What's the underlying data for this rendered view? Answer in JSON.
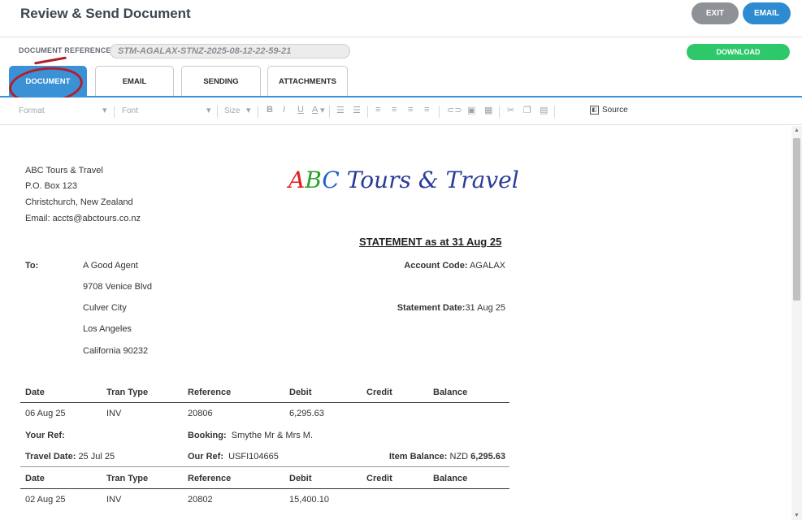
{
  "header": {
    "title": "Review & Send Document",
    "exit_label": "EXIT",
    "email_label": "EMAIL"
  },
  "reference": {
    "label": "DOCUMENT REFERENCE",
    "value": "STM-AGALAX-STNZ-2025-08-12-22-59-21",
    "download_label": "DOWNLOAD"
  },
  "tabs": [
    {
      "label": "DOCUMENT",
      "active": true
    },
    {
      "label": "EMAIL",
      "active": false
    },
    {
      "label": "SENDING",
      "active": false
    },
    {
      "label": "ATTACHMENTS",
      "active": false
    }
  ],
  "toolbar": {
    "format_label": "Format",
    "font_label": "Font",
    "size_label": "Size",
    "source_label": "Source"
  },
  "document": {
    "company": {
      "name": "ABC Tours & Travel",
      "address1": "P.O. Box 123",
      "address2": "Christchurch, New Zealand",
      "email": "Email: accts@abctours.co.nz"
    },
    "logo": {
      "abc": "ABC",
      "rest": "Tours & Travel",
      "colors": [
        "#e02020",
        "#2aa02a",
        "#1f5fcf",
        "#2a3b9a"
      ]
    },
    "statement_title": "STATEMENT as at 31 Aug 25",
    "to_label": "To:",
    "recipient": [
      "A Good Agent",
      "9708 Venice Blvd",
      "Culver City",
      "Los Angeles",
      "California 90232"
    ],
    "account_code_label": "Account Code:",
    "account_code": "AGALAX",
    "statement_date_label": "Statement Date:",
    "statement_date": "31 Aug 25",
    "columns": [
      "Date",
      "Tran Type",
      "Reference",
      "Debit",
      "Credit",
      "Balance"
    ],
    "entries": [
      {
        "date": "06 Aug 25",
        "tran_type": "INV",
        "reference": "20806",
        "debit": "6,295.63",
        "your_ref_label": "Your Ref:",
        "booking_label": "Booking:",
        "booking": "Smythe Mr & Mrs M.",
        "travel_date_label": "Travel Date:",
        "travel_date": "25 Jul 25",
        "our_ref_label": "Our Ref:",
        "our_ref": "USFI104665",
        "item_balance_label": "Item Balance:",
        "item_balance_currency": "NZD",
        "item_balance": "6,295.63"
      },
      {
        "date": "02 Aug 25",
        "tran_type": "INV",
        "reference": "20802",
        "debit": "15,400.10"
      }
    ]
  }
}
